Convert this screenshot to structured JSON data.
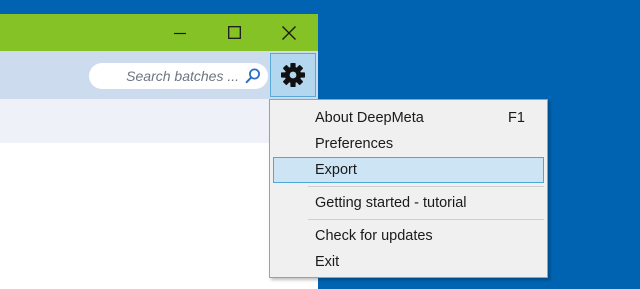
{
  "window": {
    "controls": {
      "minimize_icon": "minimize-icon",
      "maximize_icon": "maximize-icon",
      "close_icon": "close-icon"
    },
    "colors": {
      "titlebar": "#84c225",
      "toolbar": "#ccdcee",
      "desktop": "#0063b1",
      "menu_highlight": "#cce4f3"
    }
  },
  "search": {
    "placeholder": "Search batches ...",
    "icon": "search-icon"
  },
  "settings_button": {
    "icon": "gear-icon"
  },
  "menu": {
    "items": [
      {
        "label": "About DeepMeta",
        "shortcut": "F1"
      },
      {
        "label": "Preferences",
        "shortcut": ""
      },
      {
        "label": "Export",
        "shortcut": "",
        "highlighted": true
      },
      {
        "label": "Getting started - tutorial",
        "shortcut": ""
      },
      {
        "label": "Check for updates",
        "shortcut": ""
      },
      {
        "label": "Exit",
        "shortcut": ""
      }
    ]
  }
}
